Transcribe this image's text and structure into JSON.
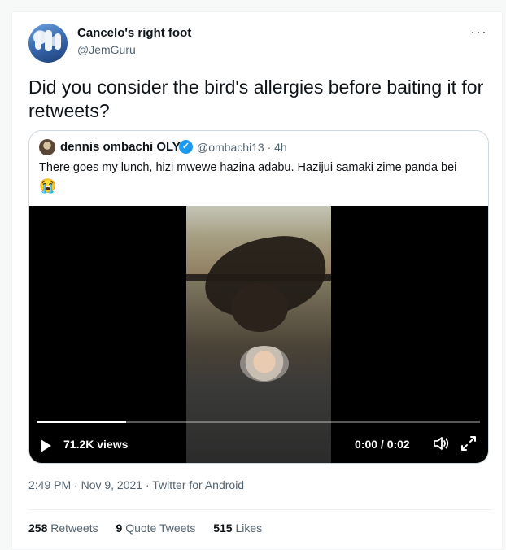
{
  "tweet": {
    "author_name": "Cancelo's right foot",
    "author_handle": "@JemGuru",
    "more_glyph": "···",
    "text": "Did you consider the bird's allergies before baiting it for retweets?",
    "timestamp": "2:49 PM · Nov 9, 2021 · Twitter for Android"
  },
  "quote": {
    "author_name": "dennis ombachi OLY",
    "verified_glyph": "✓",
    "meta": "@ombachi13 · 4h",
    "text": "There goes my lunch, hizi mwewe hazina adabu. Hazijui samaki zime panda bei",
    "emoji": "😭"
  },
  "video": {
    "views": "71.2K views",
    "time": "0:00 / 0:02",
    "progress": 0.2
  },
  "stats": {
    "retweets_count": "258",
    "retweets_label": "Retweets",
    "quotes_count": "9",
    "quotes_label": "Quote Tweets",
    "likes_count": "515",
    "likes_label": "Likes"
  },
  "colors": {
    "accent": "#1d9bf0",
    "secondary_text": "#536471"
  },
  "icons": [
    "more-icon",
    "verified-icon",
    "play-icon",
    "volume-icon",
    "fullscreen-icon"
  ]
}
